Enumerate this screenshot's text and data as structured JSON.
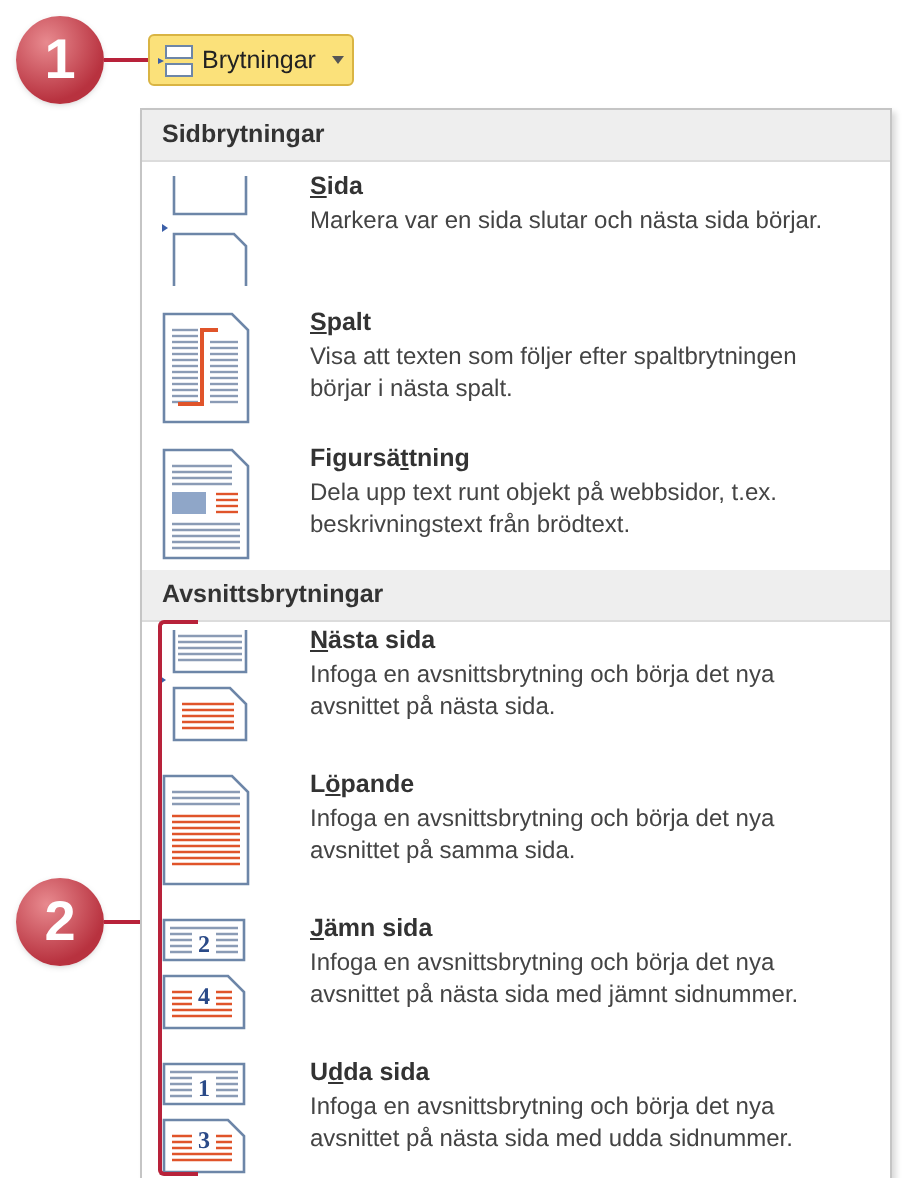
{
  "callouts": [
    {
      "number": "1"
    },
    {
      "number": "2"
    }
  ],
  "button": {
    "label": "Brytningar",
    "pressed": true
  },
  "sections": [
    {
      "title": "Sidbrytningar",
      "items": [
        {
          "kind": "page",
          "label": {
            "key": "S",
            "after": "ida"
          },
          "description": "Markera var en sida slutar och nästa sida börjar."
        },
        {
          "kind": "column",
          "label": {
            "key": "S",
            "after": "palt"
          },
          "description": "Visa att texten som följer efter spaltbrytningen börjar i nästa spalt."
        },
        {
          "kind": "wrap",
          "label": {
            "before": "Figursä",
            "key": "t",
            "after": "tning"
          },
          "description": "Dela upp text runt objekt på webbsidor, t.ex. beskrivningstext från brödtext."
        }
      ]
    },
    {
      "title": "Avsnittsbrytningar",
      "items": [
        {
          "kind": "next-page",
          "label": {
            "key": "N",
            "after": "ästa sida"
          },
          "description": "Infoga en avsnittsbrytning och börja det nya avsnittet på nästa sida."
        },
        {
          "kind": "continuous",
          "label": {
            "before": "L",
            "key": "ö",
            "after": "pande"
          },
          "description": "Infoga en avsnittsbrytning och börja det nya avsnittet på samma sida."
        },
        {
          "kind": "numbered",
          "label": {
            "key": "J",
            "after": "ämn sida"
          },
          "icon_numbers": [
            "2",
            "4"
          ],
          "description": "Infoga en avsnittsbrytning och börja det nya avsnittet på nästa sida med jämnt sidnummer."
        },
        {
          "kind": "numbered",
          "label": {
            "before": "U",
            "key": "d",
            "after": "da sida"
          },
          "icon_numbers": [
            "1",
            "3"
          ],
          "description": "Infoga en avsnittsbrytning och börja det nya avsnittet på nästa sida med udda sidnummer."
        }
      ]
    }
  ]
}
